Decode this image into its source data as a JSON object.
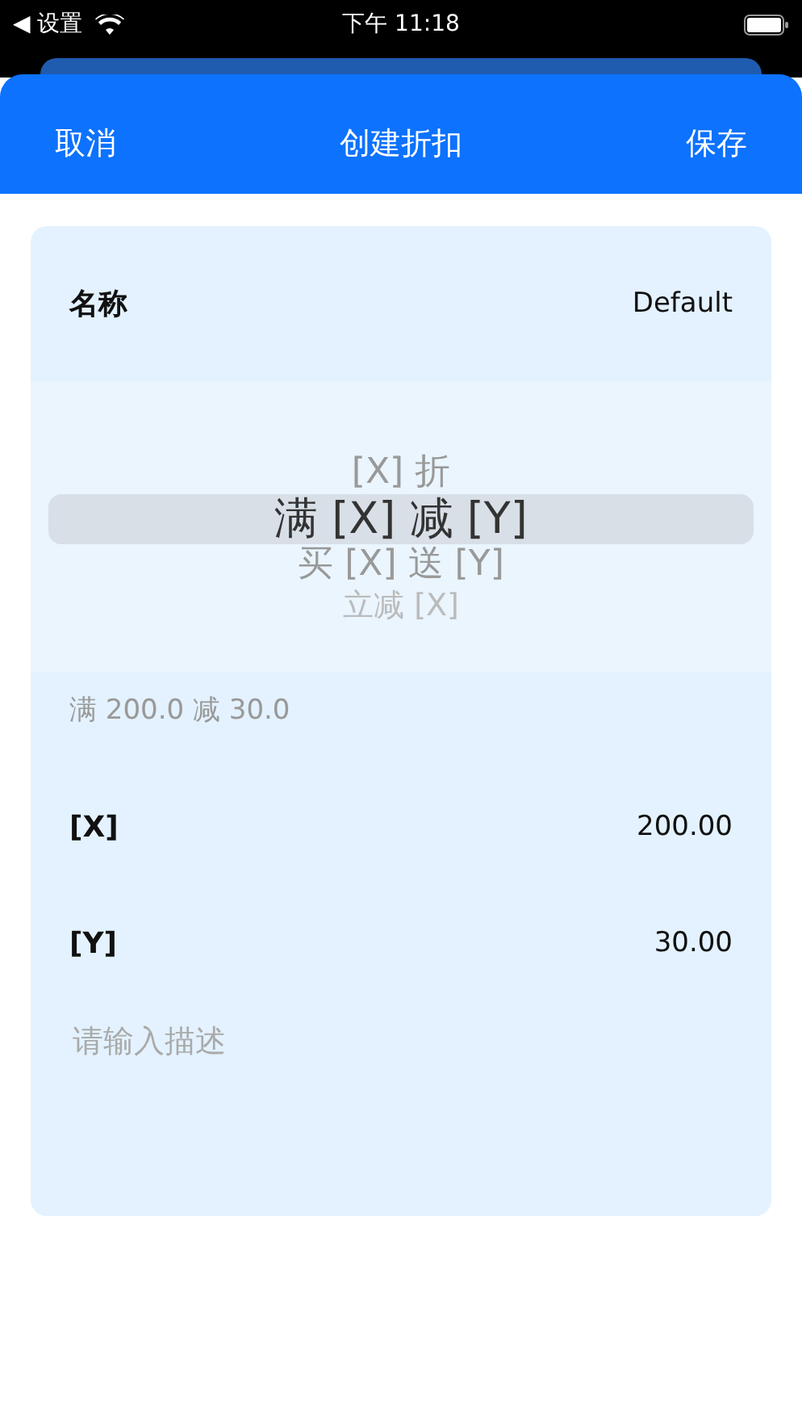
{
  "status_bar": {
    "back_label": "◀ 设置",
    "time": "下午 11:18"
  },
  "header": {
    "cancel": "取消",
    "title": "创建折扣",
    "save": "保存"
  },
  "name_row": {
    "label": "名称",
    "value": "Default"
  },
  "picker": {
    "options": [
      {
        "label": "[X] 折",
        "selected": false
      },
      {
        "label": "满 [X] 减 [Y]",
        "selected": true
      },
      {
        "label": "买 [X] 送 [Y]",
        "selected": false
      },
      {
        "label": "立减 [X]",
        "selected": false
      }
    ]
  },
  "summary": "满 200.0 减 30.0",
  "params": [
    {
      "label": "[X]",
      "value": "200.00"
    },
    {
      "label": "[Y]",
      "value": "30.00"
    }
  ],
  "description": {
    "placeholder": "请输入描述"
  }
}
